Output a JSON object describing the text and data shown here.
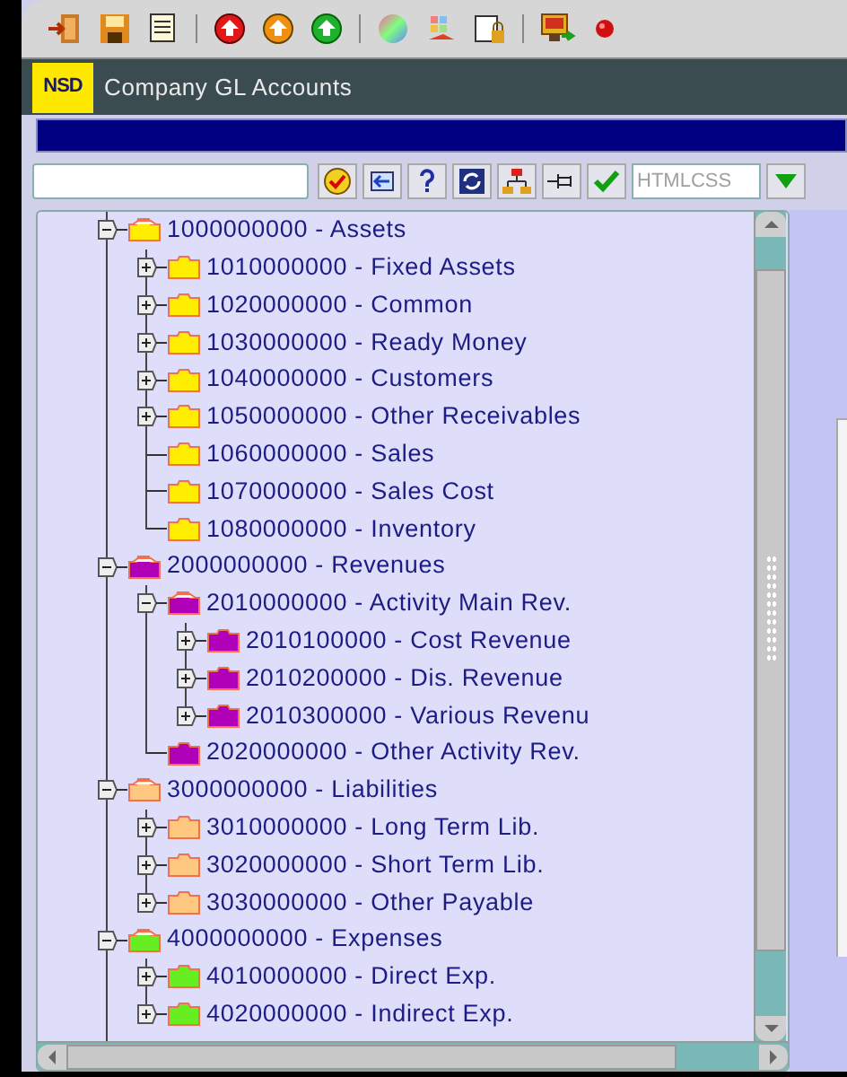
{
  "window": {
    "logo": "NSD",
    "title": "Company GL Accounts"
  },
  "format_field": {
    "placeholder": "HTMLCSS"
  },
  "tree": [
    {
      "label": "1000000000 - Assets",
      "kind": "branch",
      "expanded": true,
      "color": "#ffee00",
      "children": [
        {
          "label": "1010000000 - Fixed Assets",
          "kind": "branch",
          "expanded": false,
          "color": "#ffee00"
        },
        {
          "label": "1020000000 - Common",
          "kind": "branch",
          "expanded": false,
          "color": "#ffee00"
        },
        {
          "label": "1030000000 - Ready Money",
          "kind": "branch",
          "expanded": false,
          "color": "#ffee00"
        },
        {
          "label": "1040000000 - Customers",
          "kind": "branch",
          "expanded": false,
          "color": "#ffee00"
        },
        {
          "label": "1050000000 - Other Receivables",
          "kind": "branch",
          "expanded": false,
          "color": "#ffee00"
        },
        {
          "label": "1060000000 - Sales",
          "kind": "leaf",
          "color": "#ffee00"
        },
        {
          "label": "1070000000 - Sales Cost",
          "kind": "leaf",
          "color": "#ffee00"
        },
        {
          "label": "1080000000 - Inventory",
          "kind": "leaf",
          "color": "#ffee00"
        }
      ]
    },
    {
      "label": "2000000000 - Revenues",
      "kind": "branch",
      "expanded": true,
      "color": "#b000b8",
      "children": [
        {
          "label": "2010000000 - Activity Main Rev.",
          "kind": "branch",
          "expanded": true,
          "color": "#b000b8",
          "children": [
            {
              "label": "2010100000 - Cost Revenue",
              "kind": "branch",
              "expanded": false,
              "color": "#b000b8"
            },
            {
              "label": "2010200000 - Dis. Revenue",
              "kind": "branch",
              "expanded": false,
              "color": "#b000b8"
            },
            {
              "label": "2010300000 - Various Revenu",
              "kind": "branch",
              "expanded": false,
              "color": "#b000b8"
            }
          ]
        },
        {
          "label": "2020000000 - Other Activity Rev.",
          "kind": "leaf",
          "color": "#b000b8"
        }
      ]
    },
    {
      "label": "3000000000 - Liabilities",
      "kind": "branch",
      "expanded": true,
      "color": "#ffc880",
      "children": [
        {
          "label": "3010000000 - Long Term Lib.",
          "kind": "branch",
          "expanded": false,
          "color": "#ffc880"
        },
        {
          "label": "3020000000 - Short Term Lib.",
          "kind": "branch",
          "expanded": false,
          "color": "#ffc880"
        },
        {
          "label": "3030000000 - Other Payable",
          "kind": "branch",
          "expanded": false,
          "color": "#ffc880"
        }
      ]
    },
    {
      "label": "4000000000 - Expenses",
      "kind": "branch",
      "expanded": true,
      "color": "#66ee22",
      "children": [
        {
          "label": "4010000000 - Direct Exp.",
          "kind": "branch",
          "expanded": false,
          "color": "#66ee22"
        },
        {
          "label": "4020000000 - Indirect Exp.",
          "kind": "branch",
          "expanded": false,
          "color": "#66ee22"
        }
      ]
    }
  ]
}
